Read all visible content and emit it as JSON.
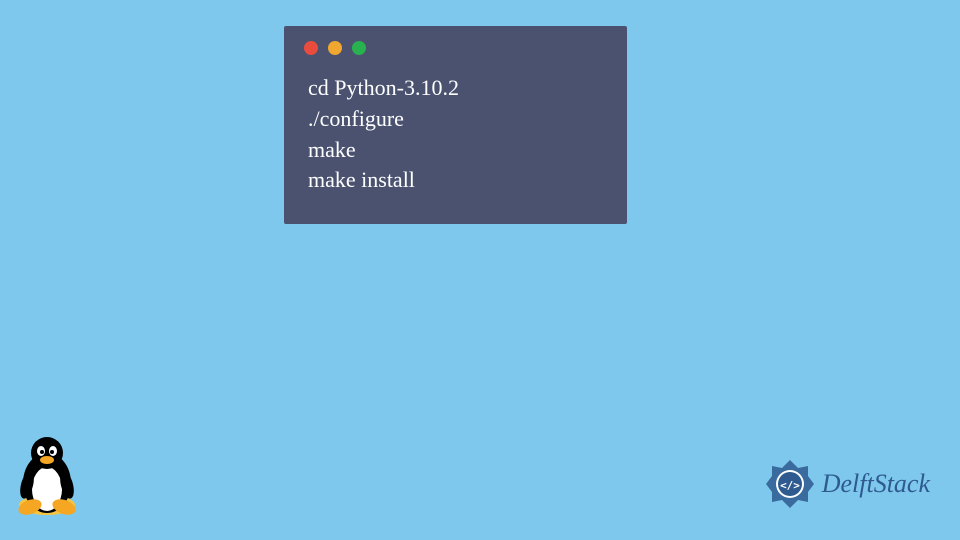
{
  "terminal": {
    "lines": [
      "cd Python-3.10.2",
      "./configure",
      "make",
      "make install"
    ]
  },
  "brand": {
    "name": "DelftStack"
  }
}
